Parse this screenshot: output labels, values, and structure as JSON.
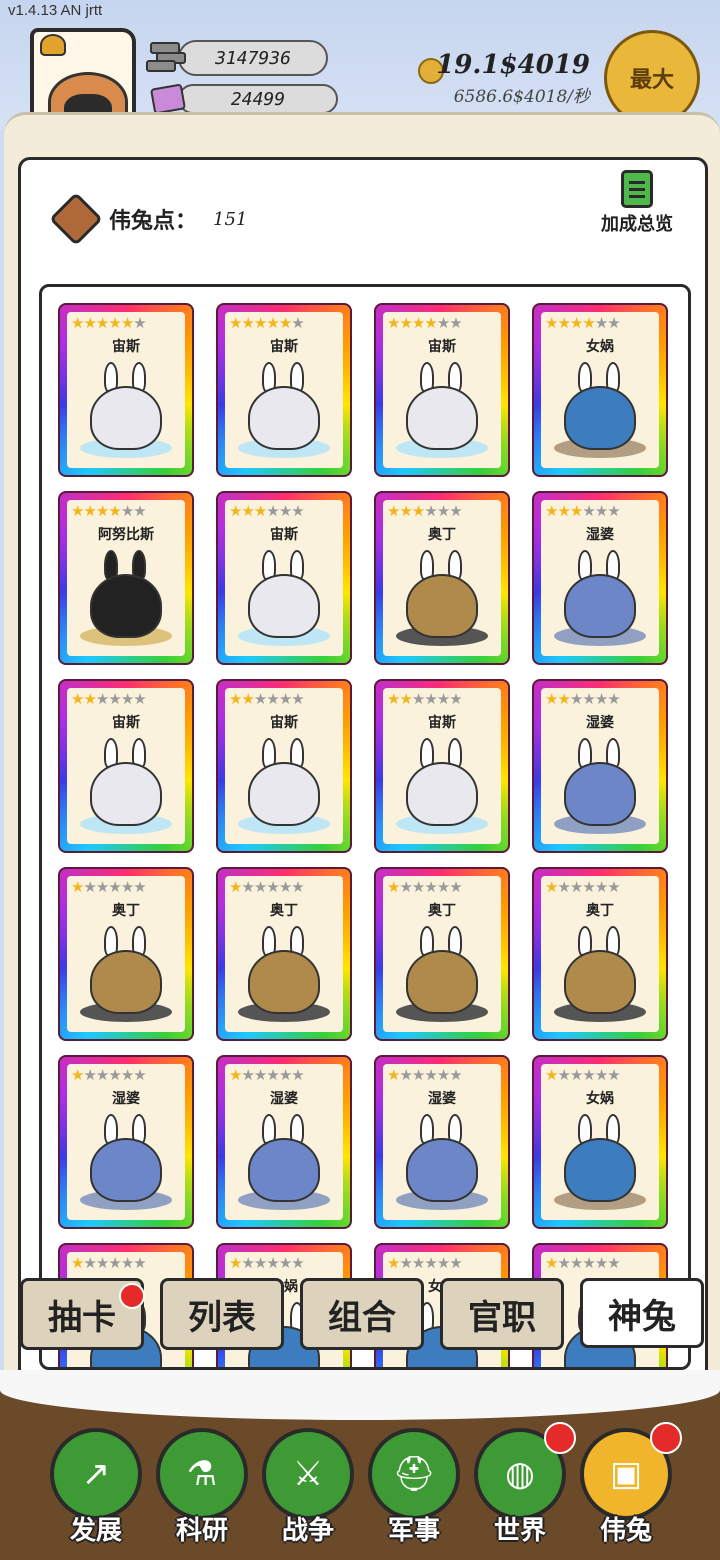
{
  "version": "v1.4.13 AN jrtt",
  "header": {
    "silver": "3147936",
    "gems": "24499",
    "gold_total": "19.1$4019",
    "gold_rate": "6586.6$4018/秒",
    "max_button": "最大"
  },
  "points": {
    "label": "伟兔点：",
    "value": "151"
  },
  "bonus_overview": "加成总览",
  "cards": [
    {
      "name": "宙斯",
      "stars": 5,
      "type": "zeus"
    },
    {
      "name": "宙斯",
      "stars": 5,
      "type": "zeus"
    },
    {
      "name": "宙斯",
      "stars": 4,
      "type": "zeus"
    },
    {
      "name": "女娲",
      "stars": 4,
      "type": "nuwa"
    },
    {
      "name": "阿努比斯",
      "stars": 4,
      "type": "anubis"
    },
    {
      "name": "宙斯",
      "stars": 3,
      "type": "zeus"
    },
    {
      "name": "奥丁",
      "stars": 3,
      "type": "odin"
    },
    {
      "name": "湿婆",
      "stars": 3,
      "type": "shiva"
    },
    {
      "name": "宙斯",
      "stars": 2,
      "type": "zeus"
    },
    {
      "name": "宙斯",
      "stars": 2,
      "type": "zeus"
    },
    {
      "name": "宙斯",
      "stars": 2,
      "type": "zeus"
    },
    {
      "name": "湿婆",
      "stars": 2,
      "type": "shiva"
    },
    {
      "name": "奥丁",
      "stars": 1,
      "type": "odin"
    },
    {
      "name": "奥丁",
      "stars": 1,
      "type": "odin"
    },
    {
      "name": "奥丁",
      "stars": 1,
      "type": "odin"
    },
    {
      "name": "奥丁",
      "stars": 1,
      "type": "odin"
    },
    {
      "name": "湿婆",
      "stars": 1,
      "type": "shiva"
    },
    {
      "name": "湿婆",
      "stars": 1,
      "type": "shiva"
    },
    {
      "name": "湿婆",
      "stars": 1,
      "type": "shiva"
    },
    {
      "name": "女娲",
      "stars": 1,
      "type": "nuwa"
    },
    {
      "name": "女娲",
      "stars": 1,
      "type": "nuwa"
    },
    {
      "name": "女娲",
      "stars": 1,
      "type": "nuwa"
    },
    {
      "name": "女娲",
      "stars": 1,
      "type": "nuwa"
    },
    {
      "name": "女娲",
      "stars": 1,
      "type": "nuwa"
    }
  ],
  "tabs": [
    {
      "label": "抽卡",
      "dot": true
    },
    {
      "label": "列表",
      "dot": false
    },
    {
      "label": "组合",
      "dot": false
    },
    {
      "label": "官职",
      "dot": false
    },
    {
      "label": "神兔",
      "dot": false,
      "active": true
    }
  ],
  "nav": [
    {
      "label": "发展",
      "icon": "arrow-icon",
      "glyph": "↗",
      "dot": false
    },
    {
      "label": "科研",
      "icon": "flask-icon",
      "glyph": "⚗",
      "dot": false
    },
    {
      "label": "战争",
      "icon": "swords-icon",
      "glyph": "⚔",
      "dot": false
    },
    {
      "label": "军事",
      "icon": "helmet-icon",
      "glyph": "⛑",
      "dot": false
    },
    {
      "label": "世界",
      "icon": "globe-icon",
      "glyph": "◍",
      "dot": true
    },
    {
      "label": "伟兔",
      "icon": "rabbit-frame-icon",
      "glyph": "▣",
      "dot": true,
      "active": true
    }
  ]
}
